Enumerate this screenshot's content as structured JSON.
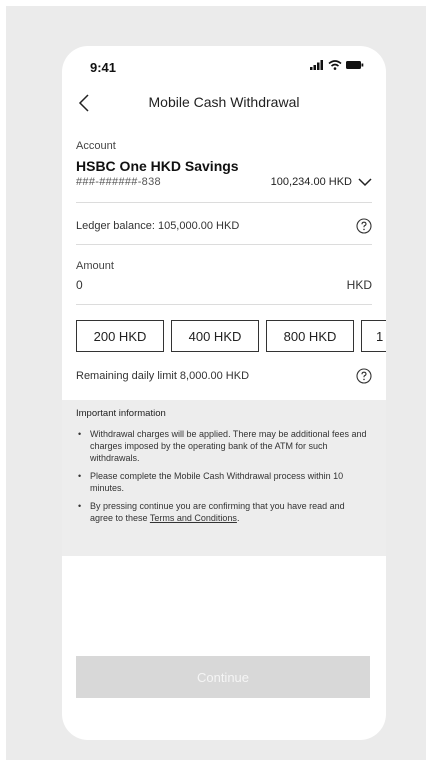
{
  "status_bar": {
    "time": "9:41"
  },
  "nav": {
    "title": "Mobile Cash Withdrawal"
  },
  "account": {
    "label": "Account",
    "name": "HSBC One HKD Savings",
    "number": "###-######-838",
    "balance": "100,234.00 HKD"
  },
  "ledger": {
    "text": "Ledger balance: 105,000.00 HKD"
  },
  "amount": {
    "label": "Amount",
    "value": "0",
    "currency": "HKD"
  },
  "quick_amounts": [
    "200 HKD",
    "400 HKD",
    "800 HKD",
    "1"
  ],
  "limit": {
    "text": "Remaining daily limit 8,000.00 HKD"
  },
  "important": {
    "title": "Important information",
    "bullet1": "Withdrawal charges will be applied. There may be additional fees and charges imposed by the operating bank of the ATM for such withdrawals.",
    "bullet2": "Please complete the Mobile Cash Withdrawal process within 10 minutes.",
    "bullet3_prefix": "By pressing continue you are confirming that you have read and agree to these ",
    "bullet3_link": "Terms and Conditions",
    "bullet3_suffix": "."
  },
  "continue_label": "Continue",
  "colors": {
    "background": "#ebebeb",
    "info_panel": "#ededed",
    "continue_disabled": "#d8d8d8"
  }
}
